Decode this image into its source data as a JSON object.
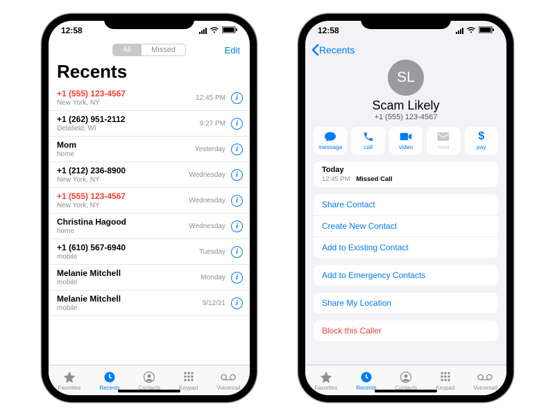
{
  "statusbar": {
    "time": "12:58"
  },
  "phoneA": {
    "segment": {
      "all": "All",
      "missed": "Missed"
    },
    "edit": "Edit",
    "title": "Recents",
    "calls": [
      {
        "name": "+1 (555) 123-4567",
        "sub": "New York, NY",
        "time": "12:45 PM",
        "missed": true
      },
      {
        "name": "+1 (262) 951-2112",
        "sub": "Delafield, WI",
        "time": "9:27 PM",
        "missed": false
      },
      {
        "name": "Mom",
        "sub": "home",
        "time": "Yesterday",
        "missed": false
      },
      {
        "name": "+1 (212) 236-8900",
        "sub": "New York, NY",
        "time": "Wednesday",
        "missed": false
      },
      {
        "name": "+1 (555) 123-4567",
        "sub": "New York, NY",
        "time": "Wednesday",
        "missed": true
      },
      {
        "name": "Christina Hagood",
        "sub": "home",
        "time": "Wednesday",
        "missed": false
      },
      {
        "name": "+1 (610) 567-6940",
        "sub": "mobile",
        "time": "Tuesday",
        "missed": false
      },
      {
        "name": "Melanie Mitchell",
        "sub": "mobile",
        "time": "Monday",
        "missed": false
      },
      {
        "name": "Melanie Mitchell",
        "sub": "mobile",
        "time": "9/12/21",
        "missed": false
      }
    ]
  },
  "phoneB": {
    "back": "Recents",
    "avatarInitials": "SL",
    "contactName": "Scam Likely",
    "contactNumber": "+1 (555) 123-4567",
    "actions": {
      "message": "message",
      "call": "call",
      "video": "video",
      "mail": "mail",
      "pay": "pay"
    },
    "todayLabel": "Today",
    "todayTime": "12:45 PM",
    "todayEvent": "Missed Call",
    "menu1": [
      "Share Contact",
      "Create New Contact",
      "Add to Existing Contact"
    ],
    "menu2": [
      "Add to Emergency Contacts"
    ],
    "menu3": [
      "Share My Location"
    ],
    "block": "Block this Caller"
  },
  "tabs": {
    "favorites": "Favorites",
    "recents": "Recents",
    "contacts": "Contacts",
    "keypad": "Keypad",
    "voicemail": "Voicemail"
  }
}
